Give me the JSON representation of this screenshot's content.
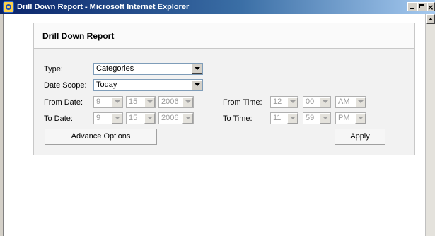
{
  "window": {
    "title": "Drill Down Report - Microsoft Internet Explorer"
  },
  "report": {
    "title": "Drill Down Report",
    "type_label": "Type:",
    "type_value": "Categories",
    "date_scope_label": "Date Scope:",
    "date_scope_value": "Today",
    "from_date_label": "From Date:",
    "from_date": {
      "month": "9",
      "day": "15",
      "year": "2006"
    },
    "to_date_label": "To Date:",
    "to_date": {
      "month": "9",
      "day": "15",
      "year": "2006"
    },
    "from_time_label": "From Time:",
    "from_time": {
      "hour": "12",
      "minute": "00",
      "ampm": "AM"
    },
    "to_time_label": "To Time:",
    "to_time": {
      "hour": "11",
      "minute": "59",
      "ampm": "PM"
    },
    "advance_options_label": "Advance Options",
    "apply_label": "Apply"
  },
  "icons": [
    "ie-icon",
    "minimize-icon",
    "maximize-icon",
    "close-icon",
    "scroll-up-icon",
    "dropdown-arrow-icon"
  ]
}
